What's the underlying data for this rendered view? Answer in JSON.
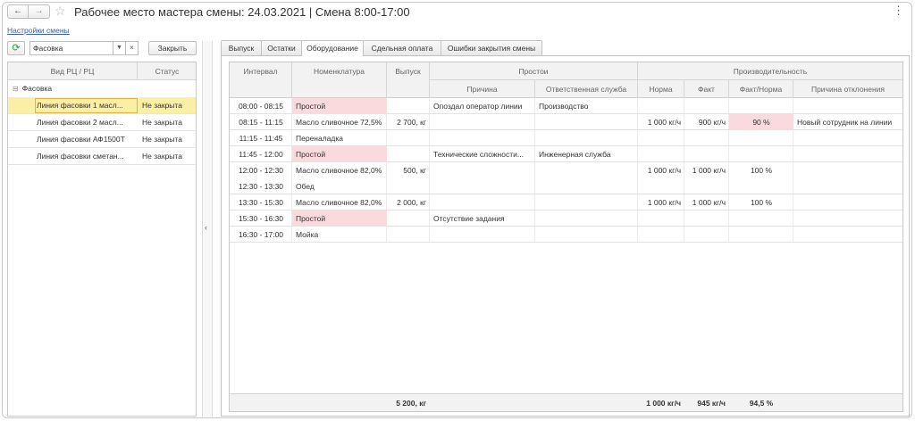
{
  "window": {
    "title": "Рабочее место мастера смены: 24.03.2021 | Смена 8:00-17:00",
    "back_icon": "arrow-left-icon",
    "forward_icon": "arrow-right-icon",
    "favorite_icon": "star-icon",
    "menu_icon": "more-vertical-icon",
    "settings_link": "Настройки смены"
  },
  "left_panel": {
    "filter_value": "Фасовка",
    "close_button": "Закрыть",
    "columns": [
      "Вид РЦ / РЦ",
      "Статус"
    ],
    "group": "Фасовка",
    "items": [
      {
        "name": "Линия фасовки 1 масл...",
        "status": "Не закрыта",
        "selected": true
      },
      {
        "name": "Линия фасовки 2 масл...",
        "status": "Не закрыта",
        "selected": false
      },
      {
        "name": "Линия фасовки АФ1500Т",
        "status": "Не закрыта",
        "selected": false
      },
      {
        "name": "Линия фасовки сметан...",
        "status": "Не закрыта",
        "selected": false
      }
    ]
  },
  "tabs": [
    {
      "label": "Выпуск",
      "active": false
    },
    {
      "label": "Остатки",
      "active": false
    },
    {
      "label": "Оборудование",
      "active": true
    },
    {
      "label": "Сдельная оплата",
      "active": false
    },
    {
      "label": "Ошибки закрытия смены",
      "active": false
    }
  ],
  "grid": {
    "headers": {
      "interval": "Интервал",
      "nomenclature": "Номенклатура",
      "output": "Выпуск",
      "downtime": "Простои",
      "reason": "Причина",
      "responsible": "Ответственная служба",
      "productivity": "Производительность",
      "norm": "Норма",
      "fact": "Факт",
      "fact_norm": "Факт/Норма",
      "deviation_reason": "Причина отклонения"
    },
    "rows": [
      {
        "interval": "08:00 - 08:15",
        "nomenclature": "Простой",
        "output": "",
        "reason": "Опоздал оператор линии",
        "responsible": "Производство",
        "norm": "",
        "fact": "",
        "fact_norm": "",
        "deviation": "",
        "downtime": true,
        "fn_alert": false,
        "sep": true
      },
      {
        "interval": "08:15 - 11:15",
        "nomenclature": "Масло сливочное 72,5%",
        "output": "2 700, кг",
        "reason": "",
        "responsible": "",
        "norm": "1 000 кг/ч",
        "fact": "900 кг/ч",
        "fact_norm": "90 %",
        "deviation": "Новый сотрудник на линии",
        "downtime": false,
        "fn_alert": true,
        "sep": true
      },
      {
        "interval": "11:15 - 11:45",
        "nomenclature": "Переналадка",
        "output": "",
        "reason": "",
        "responsible": "",
        "norm": "",
        "fact": "",
        "fact_norm": "",
        "deviation": "",
        "downtime": false,
        "fn_alert": false,
        "sep": true
      },
      {
        "interval": "11:45 - 12:00",
        "nomenclature": "Простой",
        "output": "",
        "reason": "Технические сложности...",
        "responsible": "Инженерная служба",
        "norm": "",
        "fact": "",
        "fact_norm": "",
        "deviation": "",
        "downtime": true,
        "fn_alert": false,
        "sep": true
      },
      {
        "interval": "12:00 - 12:30",
        "nomenclature": "Масло сливочное 82,0%",
        "output": "500, кг",
        "reason": "",
        "responsible": "",
        "norm": "1 000 кг/ч",
        "fact": "1 000 кг/ч",
        "fact_norm": "100 %",
        "deviation": "",
        "downtime": false,
        "fn_alert": false,
        "sep": false
      },
      {
        "interval": "12:30 - 13:30",
        "nomenclature": "Обед",
        "output": "",
        "reason": "",
        "responsible": "",
        "norm": "",
        "fact": "",
        "fact_norm": "",
        "deviation": "",
        "downtime": false,
        "fn_alert": false,
        "sep": true
      },
      {
        "interval": "13:30 - 15:30",
        "nomenclature": "Масло сливочное 82,0%",
        "output": "2 000, кг",
        "reason": "",
        "responsible": "",
        "norm": "1 000 кг/ч",
        "fact": "1 000 кг/ч",
        "fact_norm": "100 %",
        "deviation": "",
        "downtime": false,
        "fn_alert": false,
        "sep": true
      },
      {
        "interval": "15:30 - 16:30",
        "nomenclature": "Простой",
        "output": "",
        "reason": "Отсутствие задания",
        "responsible": "",
        "norm": "",
        "fact": "",
        "fact_norm": "",
        "deviation": "",
        "downtime": true,
        "fn_alert": false,
        "sep": true
      },
      {
        "interval": "16:30 - 17:00",
        "nomenclature": "Мойка",
        "output": "",
        "reason": "",
        "responsible": "",
        "norm": "",
        "fact": "",
        "fact_norm": "",
        "deviation": "",
        "downtime": false,
        "fn_alert": false,
        "sep": true
      }
    ],
    "totals": {
      "output": "5 200, кг",
      "norm": "1 000 кг/ч",
      "fact": "945 кг/ч",
      "fact_norm": "94,5 %"
    }
  },
  "colors": {
    "selection": "#fbeea5",
    "downtime": "#fadadd",
    "link": "#3a5ea8",
    "refresh": "#2e9a3a"
  }
}
